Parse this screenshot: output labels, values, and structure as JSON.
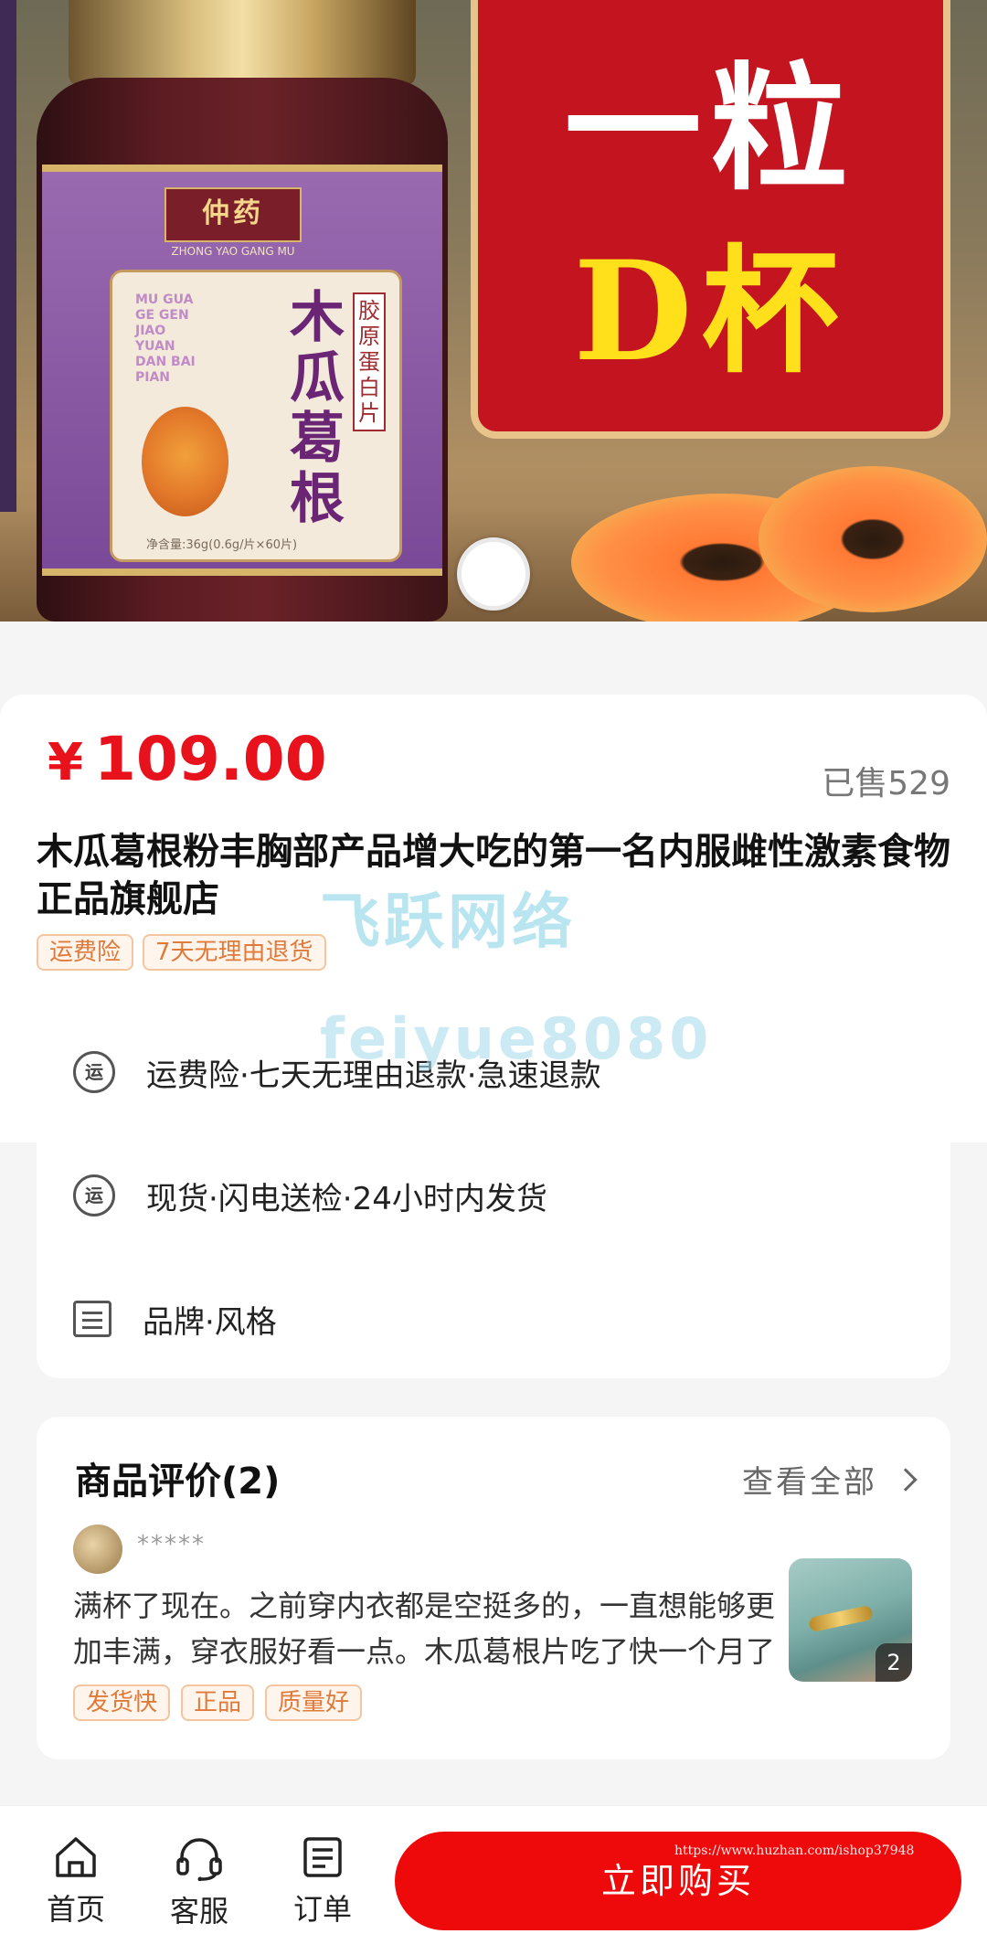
{
  "hero": {
    "brand": "仲药",
    "brand_sub": "ZHONG YAO GANG MU",
    "product_name": "木瓜葛根",
    "product_sub": "胶原蛋白片",
    "pinyin": "MU GUA GE GEN JIAO YUAN DAN BAI PIAN",
    "net_weight": "净含量:36g(0.6g/片×60片)",
    "promo_line1": "一粒",
    "promo_line2": "D杯"
  },
  "product": {
    "price_symbol": "¥",
    "price": "109.00",
    "sold": "已售529",
    "title": "木瓜葛根粉丰胸部产品增大吃的第一名内服雌性激素食物正品旗舰店",
    "tags": [
      "运费险",
      "7天无理由退货"
    ]
  },
  "watermarks": {
    "text1": "飞跃网络",
    "text2": "feiyue8080",
    "url": "https://www.huzhan.com/ishop37948"
  },
  "services": [
    {
      "icon": "shipping-insurance-icon",
      "icon_text": "运",
      "text": "运费险·七天无理由退款·急速退款"
    },
    {
      "icon": "shipping-icon",
      "icon_text": "运",
      "text": "现货·闪电送检·24小时内发货"
    },
    {
      "icon": "document-icon",
      "icon_text": "",
      "text": "品牌·风格"
    }
  ],
  "reviews": {
    "title": "商品评价(2)",
    "view_all": "查看全部",
    "user": "*****",
    "text": "满杯了现在。之前穿内衣都是空挺多的，一直想能够更加丰满，穿衣服好看一点。木瓜葛根片吃了快一个月了",
    "tags": [
      "发货快",
      "正品",
      "质量好"
    ],
    "photo_count": "2"
  },
  "bottom_nav": {
    "home": "首页",
    "service": "客服",
    "orders": "订单",
    "buy": "立即购买"
  },
  "colors": {
    "accent": "#ee0a0a",
    "price": "#e8121d",
    "tag_text": "#e07a3a",
    "tag_bg": "#fff5ec"
  }
}
